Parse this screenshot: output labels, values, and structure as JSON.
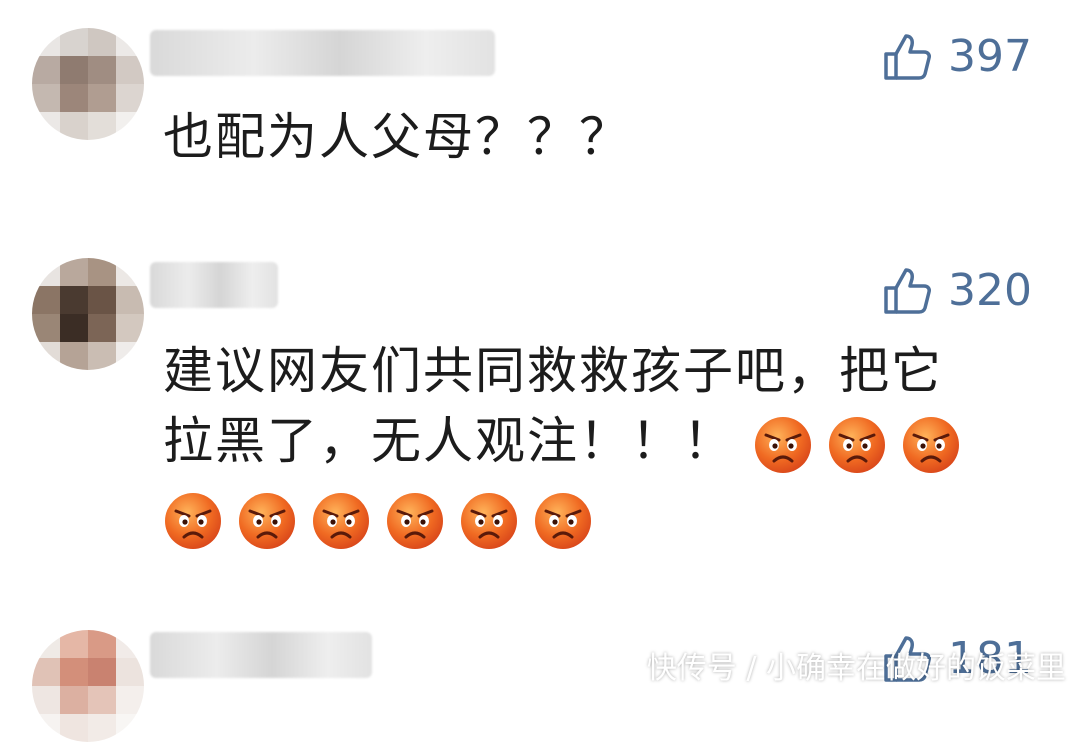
{
  "comments": [
    {
      "likes": "397",
      "text_lines": [
        "也配为人父母？？？"
      ],
      "emoji_count": 0
    },
    {
      "likes": "320",
      "text_lines": [
        "建议网友们共同救救孩子吧，把它",
        "拉黑了，无人观注！！！"
      ],
      "emoji_count": 9
    },
    {
      "likes": "181",
      "text_lines": [],
      "emoji_count": 0
    }
  ],
  "emoji_name": "angry-face-icon",
  "watermark": "快传号 / 小确幸在做好的饭菜里",
  "colors": {
    "like": "#4e6f98",
    "text": "#1c1c1c",
    "emoji": "#f06a22"
  }
}
